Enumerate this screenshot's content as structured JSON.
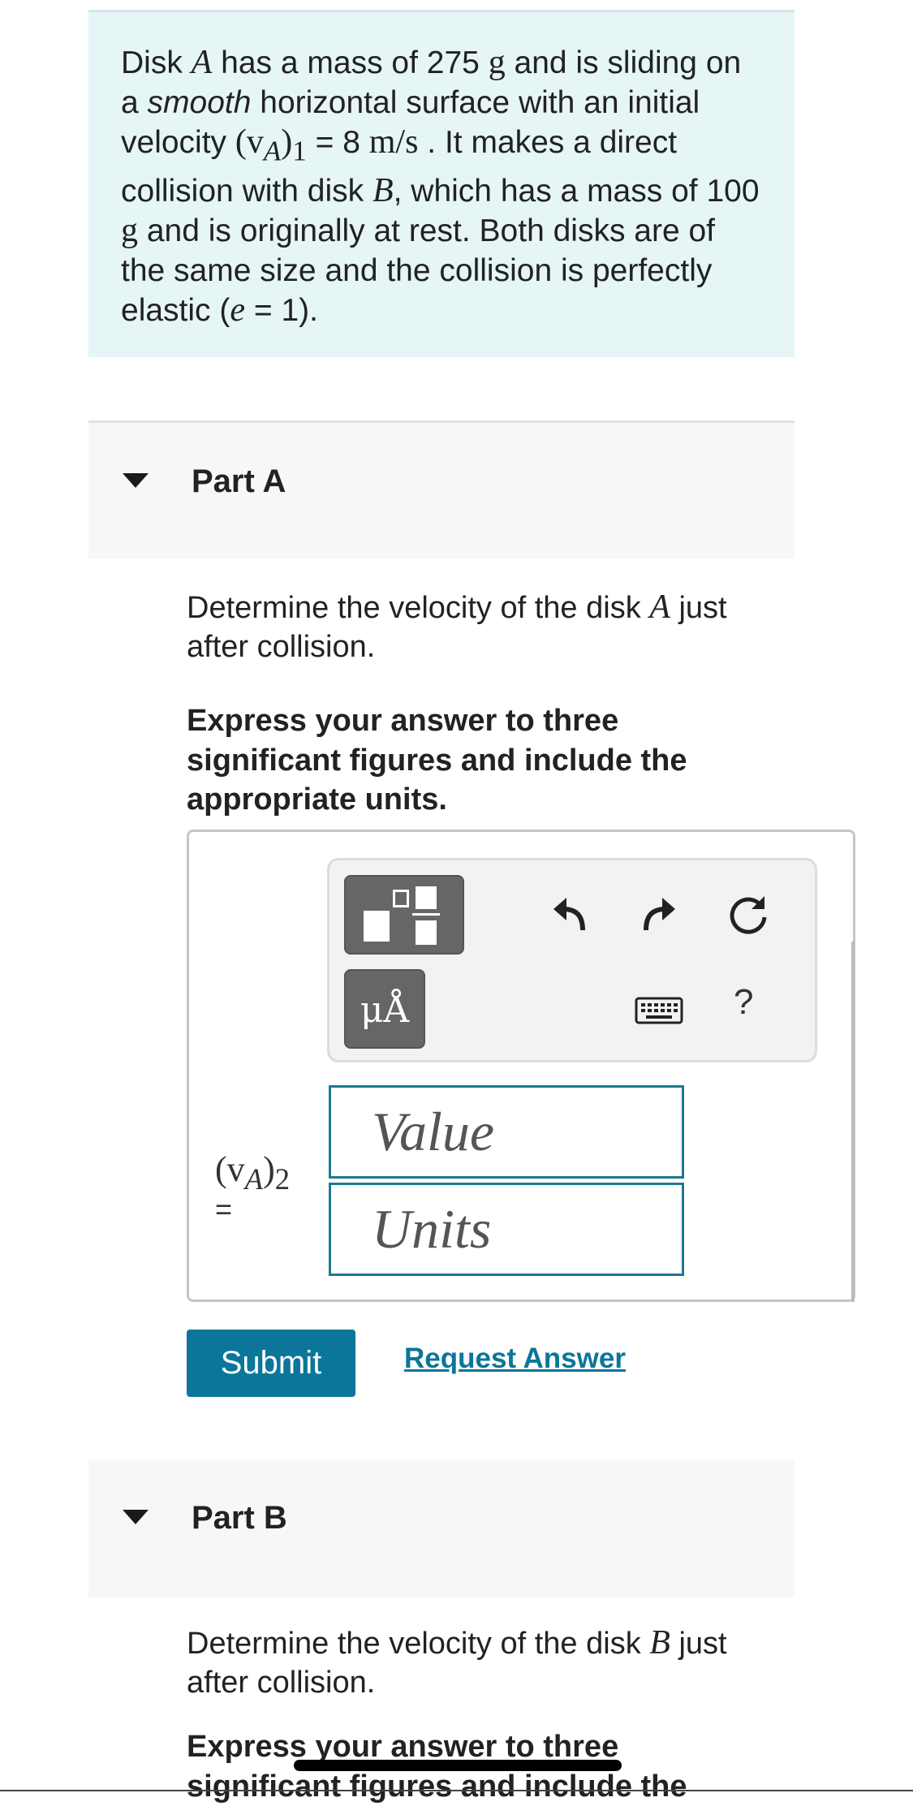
{
  "problem": {
    "s1": "Disk ",
    "diskA": "A",
    "s2": " has a mass of 275 ",
    "unit_g1": "g",
    "s3": " and is sliding on a ",
    "smooth": "smooth",
    "s4": " horizontal surface with an initial velocity ",
    "v_sym": "(v",
    "v_sub": "A",
    "v_close": ")",
    "v_idx": "1",
    "s5": " = 8 ",
    "unit_ms": "m/s",
    "s6": " . It makes a direct collision with disk ",
    "diskB": "B",
    "s7": ", which has a mass of 100 ",
    "unit_g2": "g",
    "s8": " and is originally at rest. Both disks are of the same size and the collision is perfectly elastic (",
    "e_sym": "e",
    "s9": " = 1)."
  },
  "partA": {
    "title": "Part A",
    "q_pre": "Determine the velocity of the disk ",
    "q_var": "A",
    "q_post": " just after collision.",
    "instruction": "Express your answer to three significant figures and include the appropriate units.",
    "var_label": "(v",
    "var_sub": "A",
    "var_close": ")",
    "var_idx": "2",
    "var_eq": "=",
    "value_placeholder": "Value",
    "units_placeholder": "Units",
    "units_button": "μÅ",
    "help": "?",
    "submit": "Submit",
    "request_answer": "Request Answer"
  },
  "partB": {
    "title": "Part B",
    "q_pre": "Determine the velocity of the disk ",
    "q_var": "B",
    "q_post": " just after collision.",
    "instruction": "Express your answer to three significant figures and include the"
  },
  "icons": {
    "templates": "templates-icon",
    "units": "units-icon",
    "undo": "undo-icon",
    "redo": "redo-icon",
    "reset": "reset-icon",
    "keyboard": "keyboard-icon",
    "help": "help-icon",
    "caret": "caret-down-icon"
  },
  "colors": {
    "accent": "#0b7699",
    "problem_bg": "#e6f5f5",
    "field_border": "#1c7a8c"
  }
}
